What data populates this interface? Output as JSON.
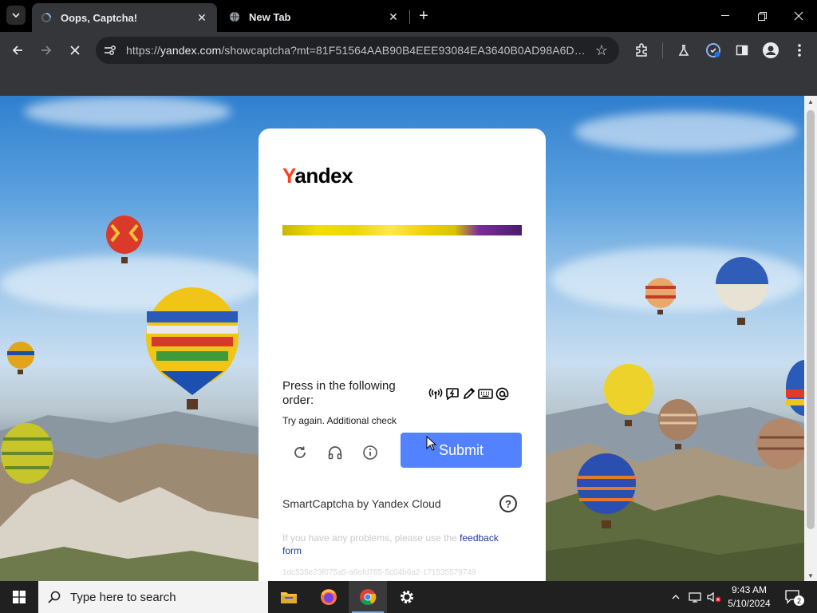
{
  "browser": {
    "tabs": [
      {
        "title": "Oops, Captcha!",
        "active": true
      },
      {
        "title": "New Tab",
        "active": false
      }
    ],
    "url_prefix": "https://",
    "url_host": "yandex.com",
    "url_rest": "/showcaptcha?mt=81F51564AAB90B4EEE93084EA3640B0AD98A6D4890...",
    "icons": {
      "tab_search": "chevron-down-icon",
      "back": "back-arrow-icon",
      "forward": "forward-arrow-icon",
      "stop": "stop-loading-icon",
      "site_info": "site-info-icon",
      "bookmark": "star-icon",
      "extensions": "puzzle-icon",
      "labs": "flask-icon",
      "profile": "profile-icon",
      "menu": "kebab-menu-icon"
    }
  },
  "captcha": {
    "logo_first": "Y",
    "logo_rest": "andex",
    "instruction": "Press in the following order:",
    "order_icons": [
      "broadcast-icon",
      "lightning-bubble-icon",
      "pencil-icon",
      "keyboard-icon",
      "at-sign-icon"
    ],
    "error": "Try again. Additional check",
    "submit_label": "Submit",
    "provider": "SmartCaptcha by Yandex Cloud",
    "help_label": "?",
    "problems_text": "If you have any problems, please use the ",
    "feedback_link": "feedback form",
    "token": "1dc535e23f075a5-a0ofd765-5c04b6a2-171535579749"
  },
  "taskbar": {
    "search_placeholder": "Type here to search",
    "time": "9:43 AM",
    "date": "5/10/2024",
    "notifications": "2",
    "colors": {
      "accent": "#5282ff",
      "yandex_red": "#fc3f1d"
    }
  }
}
